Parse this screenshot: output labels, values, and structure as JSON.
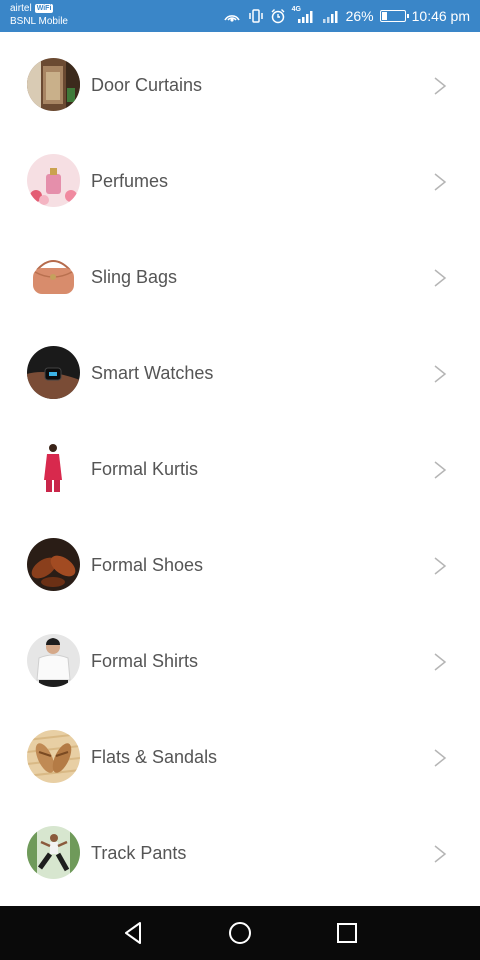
{
  "status_bar": {
    "carrier_1": "airtel",
    "carrier_1_badge": "WiFi",
    "carrier_2": "BSNL Mobile",
    "network_label": "4G",
    "battery": "26%",
    "battery_level": 0.26,
    "time": "10:46 pm",
    "icons": [
      "hotspot-icon",
      "vibrate-icon",
      "alarm-icon",
      "signal-icon",
      "signal-icon",
      "battery-icon"
    ]
  },
  "categories": [
    {
      "label": "Door Curtains",
      "icon": "door-curtains-thumbnail"
    },
    {
      "label": "Perfumes",
      "icon": "perfumes-thumbnail"
    },
    {
      "label": "Sling Bags",
      "icon": "sling-bags-thumbnail"
    },
    {
      "label": "Smart Watches",
      "icon": "smart-watches-thumbnail"
    },
    {
      "label": "Formal Kurtis",
      "icon": "formal-kurtis-thumbnail"
    },
    {
      "label": "Formal Shoes",
      "icon": "formal-shoes-thumbnail"
    },
    {
      "label": "Formal Shirts",
      "icon": "formal-shirts-thumbnail"
    },
    {
      "label": "Flats & Sandals",
      "icon": "flats-sandals-thumbnail"
    },
    {
      "label": "Track Pants",
      "icon": "track-pants-thumbnail"
    }
  ],
  "nav_bar": {
    "icons": [
      "back-icon",
      "home-icon",
      "recents-icon"
    ]
  },
  "colors": {
    "status_bar": "#3a86c8",
    "label_text": "#555555",
    "chevron": "#b5b5b5",
    "nav_bar": "#0a0a0a"
  }
}
